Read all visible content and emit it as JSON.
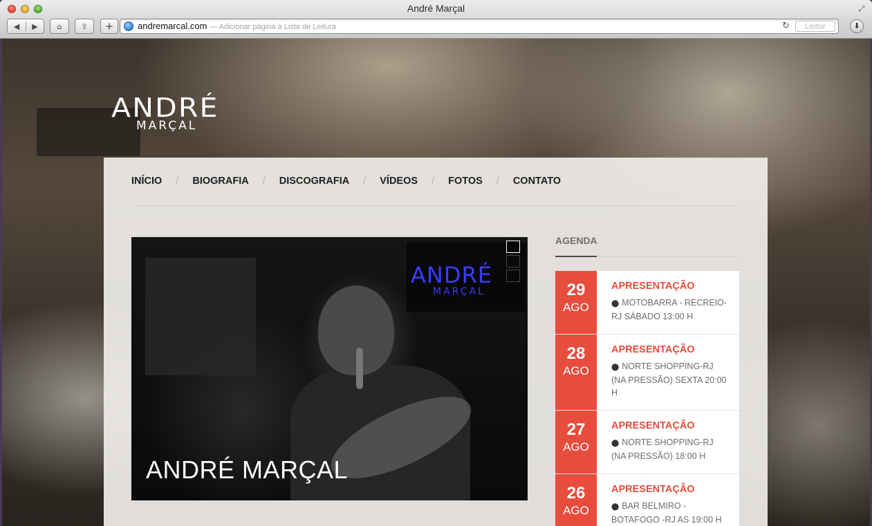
{
  "browser": {
    "window_title": "André Marçal",
    "url": "andremarcal.com",
    "url_hint": "— Adicionar página à Lista de Leitura",
    "reader_label": "Leitor",
    "icons": [
      "back-icon",
      "forward-icon",
      "home-icon",
      "share-icon",
      "plus-icon",
      "globe-icon",
      "reload-icon",
      "download-icon",
      "fullscreen-icon"
    ]
  },
  "site": {
    "logo_line1": "ANDRÉ",
    "logo_line2": "MARÇAL",
    "nav": [
      "INÍCIO",
      "BIOGRAFIA",
      "DISCOGRAFIA",
      "VÍDEOS",
      "FOTOS",
      "CONTATO"
    ],
    "nav_separator": "/",
    "slider": {
      "caption": "ANDRÉ MARÇAL",
      "logo_line1": "ANDRÉ",
      "logo_line2": "MARÇAL"
    },
    "agenda": {
      "title": "AGENDA",
      "events": [
        {
          "day": "29",
          "month": "AGO",
          "title": "APRESENTAÇÃO",
          "location": "MOTOBARRA - RECREIO-RJ SÁBADO 13:00 H"
        },
        {
          "day": "28",
          "month": "AGO",
          "title": "APRESENTAÇÃO",
          "location": "NORTE SHOPPING-RJ (NA PRESSÃO) SEXTA 20:00 H"
        },
        {
          "day": "27",
          "month": "AGO",
          "title": "APRESENTAÇÃO",
          "location": "NORTE SHOPPING-RJ (NA PRESSÃO) 18:00 H"
        },
        {
          "day": "26",
          "month": "AGO",
          "title": "APRESENTAÇÃO",
          "location": "BAR BELMIRO - BOTAFOGO -RJ AS 19:00 H"
        }
      ]
    },
    "colors": {
      "accent": "#e84c3d",
      "text": "#1e1e1e"
    }
  }
}
